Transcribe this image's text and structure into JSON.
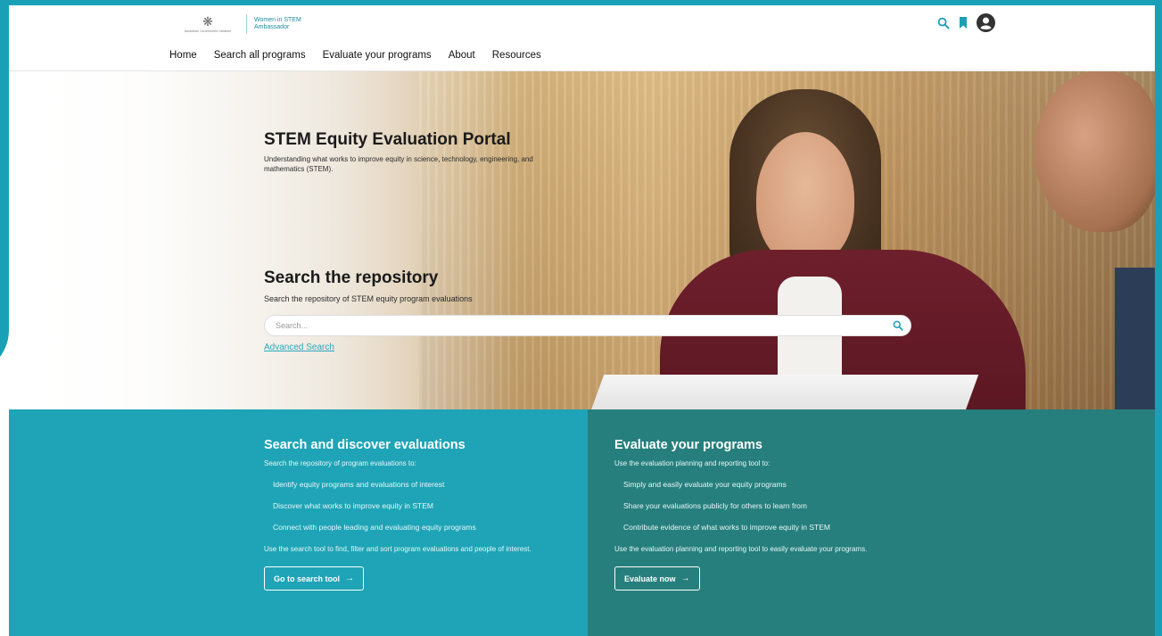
{
  "header": {
    "gov_text": "Australian Government Initiative",
    "brand_line1": "Women in STEM",
    "brand_line2": "Ambassador",
    "icons": [
      "search-icon",
      "bookmark-icon",
      "account-icon"
    ]
  },
  "nav": {
    "items": [
      "Home",
      "Search all programs",
      "Evaluate your programs",
      "About",
      "Resources"
    ]
  },
  "hero": {
    "title": "STEM Equity Evaluation Portal",
    "subtitle": "Understanding what works to improve equity in science, technology, engineering, and mathematics (STEM).",
    "repo_title": "Search the repository",
    "repo_subtitle": "Search the repository of STEM equity program evaluations",
    "search_placeholder": "Search...",
    "advanced_search": "Advanced Search"
  },
  "panels": {
    "left": {
      "title": "Search and discover evaluations",
      "intro": "Search the repository of program evaluations to:",
      "items": [
        "Identify equity programs and evaluations of interest",
        "Discover what works to improve equity in STEM",
        "Connect with people leading and evaluating equity programs"
      ],
      "outro": "Use the search tool to find, filter and sort program evaluations and people of interest.",
      "cta": "Go to search tool"
    },
    "right": {
      "title": "Evaluate your programs",
      "intro": "Use the evaluation planning and reporting tool to:",
      "items": [
        "Simply and easily evaluate your equity programs",
        "Share your evaluations publicly for others to learn from",
        "Contribute evidence of what works to improve equity in STEM"
      ],
      "outro": "Use the evaluation planning and reporting tool to easily evaluate your programs.",
      "cta": "Evaluate now"
    }
  },
  "colors": {
    "accent": "#19a0b6",
    "panel_left": "#1ea4b6",
    "panel_right": "#267f7d",
    "link": "#2ba6ba"
  }
}
